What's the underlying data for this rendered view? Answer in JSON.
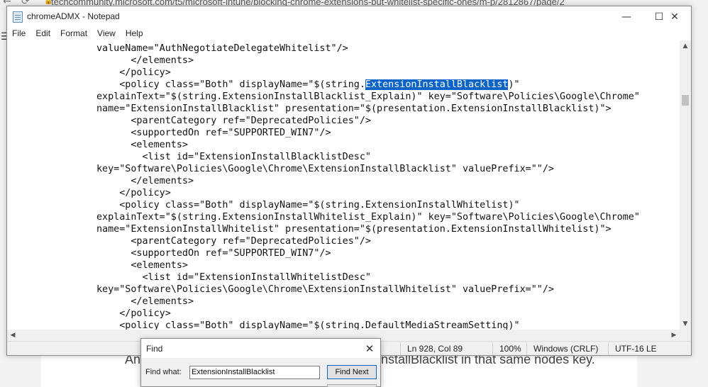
{
  "browser": {
    "url": "techcommunity.microsoft.com/t5/microsoft-intune/blocking-chrome-extensions-but-whitelist-specific-ones/m-p/2812867/page/2",
    "page_text_left": "An",
    "page_text_right": "nstallBlacklist in that same nodes key."
  },
  "notepad": {
    "title": "chromeADMX - Notepad",
    "menu": [
      "File",
      "Edit",
      "Format",
      "View",
      "Help"
    ],
    "lines": [
      "valueName=\"AuthNegotiateDelegateWhitelist\"/>",
      "      </elements>",
      "    </policy>",
      "    <policy class=\"Both\" displayName=\"$(string.",
      "explainText=\"$(string.ExtensionInstallBlacklist_Explain)\" key=\"Software\\Policies\\Google\\Chrome\"",
      "name=\"ExtensionInstallBlacklist\" presentation=\"$(presentation.ExtensionInstallBlacklist)\">",
      "      <parentCategory ref=\"DeprecatedPolicies\"/>",
      "      <supportedOn ref=\"SUPPORTED_WIN7\"/>",
      "      <elements>",
      "        <list id=\"ExtensionInstallBlacklistDesc\"",
      "key=\"Software\\Policies\\Google\\Chrome\\ExtensionInstallBlacklist\" valuePrefix=\"\"/>",
      "      </elements>",
      "    </policy>",
      "    <policy class=\"Both\" displayName=\"$(string.ExtensionInstallWhitelist)\"",
      "explainText=\"$(string.ExtensionInstallWhitelist_Explain)\" key=\"Software\\Policies\\Google\\Chrome\"",
      "name=\"ExtensionInstallWhitelist\" presentation=\"$(presentation.ExtensionInstallWhitelist)\">",
      "      <parentCategory ref=\"DeprecatedPolicies\"/>",
      "      <supportedOn ref=\"SUPPORTED_WIN7\"/>",
      "      <elements>",
      "        <list id=\"ExtensionInstallWhitelistDesc\"",
      "key=\"Software\\Policies\\Google\\Chrome\\ExtensionInstallWhitelist\" valuePrefix=\"\"/>",
      "      </elements>",
      "    </policy>",
      "    <policy class=\"Both\" displayName=\"$(string.DefaultMediaStreamSetting)\""
    ],
    "selected_text": "ExtensionInstallBlacklist",
    "selected_line_suffix": ")\"",
    "status": {
      "position": "Ln 928, Col 89",
      "zoom": "100%",
      "line_ending": "Windows (CRLF)",
      "encoding": "UTF-16 LE"
    },
    "selection_color": "#0a64c8"
  },
  "find_dialog": {
    "title": "Find",
    "label": "Find what:",
    "value": "ExtensionInstallBlacklist",
    "find_next_label": "Find Next"
  }
}
